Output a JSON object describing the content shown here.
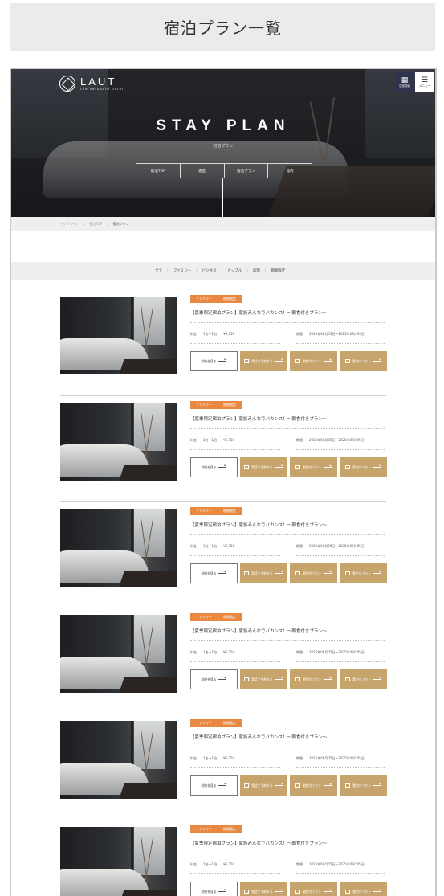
{
  "page_title": "宿泊プラン一覧",
  "site": {
    "logo_name": "LAUT",
    "logo_sub": "the setouchi hotel",
    "reserve_label": "空室検索",
    "menu_label": "メニュー"
  },
  "hero": {
    "title": "STAY PLAN",
    "subtitle": "宿泊プラン",
    "nav": [
      "宿泊TOP",
      "客室",
      "宿泊プラン",
      "館内"
    ]
  },
  "breadcrumb": [
    "トップページ",
    "宿泊TOP",
    "宿泊プラン"
  ],
  "filters": [
    "全て",
    "ファミリー",
    "ビジネス",
    "カップル",
    "早割",
    "期間限定"
  ],
  "plans": [
    {
      "tags": [
        "ファミリー",
        "期間限定"
      ],
      "title": "【夏季限定宿泊プラン】家族みんなでバカンス！〜朝食付きプラン〜",
      "price_label": "料金",
      "price_unit": "1名〜1泊",
      "price": "¥6,750",
      "period_label": "期間",
      "period": "2025年08月05日〜2025年09月05日"
    },
    {
      "tags": [
        "ファミリー",
        "期間限定"
      ],
      "title": "【夏季限定宿泊プラン】家族みんなでバカンス！〜朝食付きプラン〜",
      "price_label": "料金",
      "price_unit": "1名〜1泊",
      "price": "¥6,750",
      "period_label": "期間",
      "period": "2025年08月05日〜2025年09月05日"
    },
    {
      "tags": [
        "ファミリー",
        "期間限定"
      ],
      "title": "【夏季限定宿泊プラン】家族みんなでバカンス！〜朝食付きプラン〜",
      "price_label": "料金",
      "price_unit": "1名〜1泊",
      "price": "¥6,750",
      "period_label": "期間",
      "period": "2025年08月05日〜2025年09月05日"
    },
    {
      "tags": [
        "ファミリー",
        "期間限定"
      ],
      "title": "【夏季限定宿泊プラン】家族みんなでバカンス！〜朝食付きプラン〜",
      "price_label": "料金",
      "price_unit": "1名〜1泊",
      "price": "¥6,750",
      "period_label": "期間",
      "period": "2025年08月05日〜2025年09月05日"
    },
    {
      "tags": [
        "ファミリー",
        "期間限定"
      ],
      "title": "【夏季限定宿泊プラン】家族みんなでバカンス！〜朝食付きプラン〜",
      "price_label": "料金",
      "price_unit": "1名〜1泊",
      "price": "¥6,750",
      "period_label": "期間",
      "period": "2025年08月05日〜2025年09月05日"
    },
    {
      "tags": [
        "ファミリー",
        "期間限定"
      ],
      "title": "【夏季限定宿泊プラン】家族みんなでバカンス！〜朝食付きプラン〜",
      "price_label": "料金",
      "price_unit": "1名〜1泊",
      "price": "¥6,750",
      "period_label": "期間",
      "period": "2025年08月05日〜2025年09月05日"
    }
  ],
  "plan_buttons": {
    "detail": "詳細を見る",
    "tel": "電話で予約する",
    "web1": "朝食付プラン",
    "web2": "素泊りプラン"
  },
  "colors": {
    "tag": "#e98840",
    "gold_button": "#c8a46d",
    "reserve": "#2e3350"
  }
}
